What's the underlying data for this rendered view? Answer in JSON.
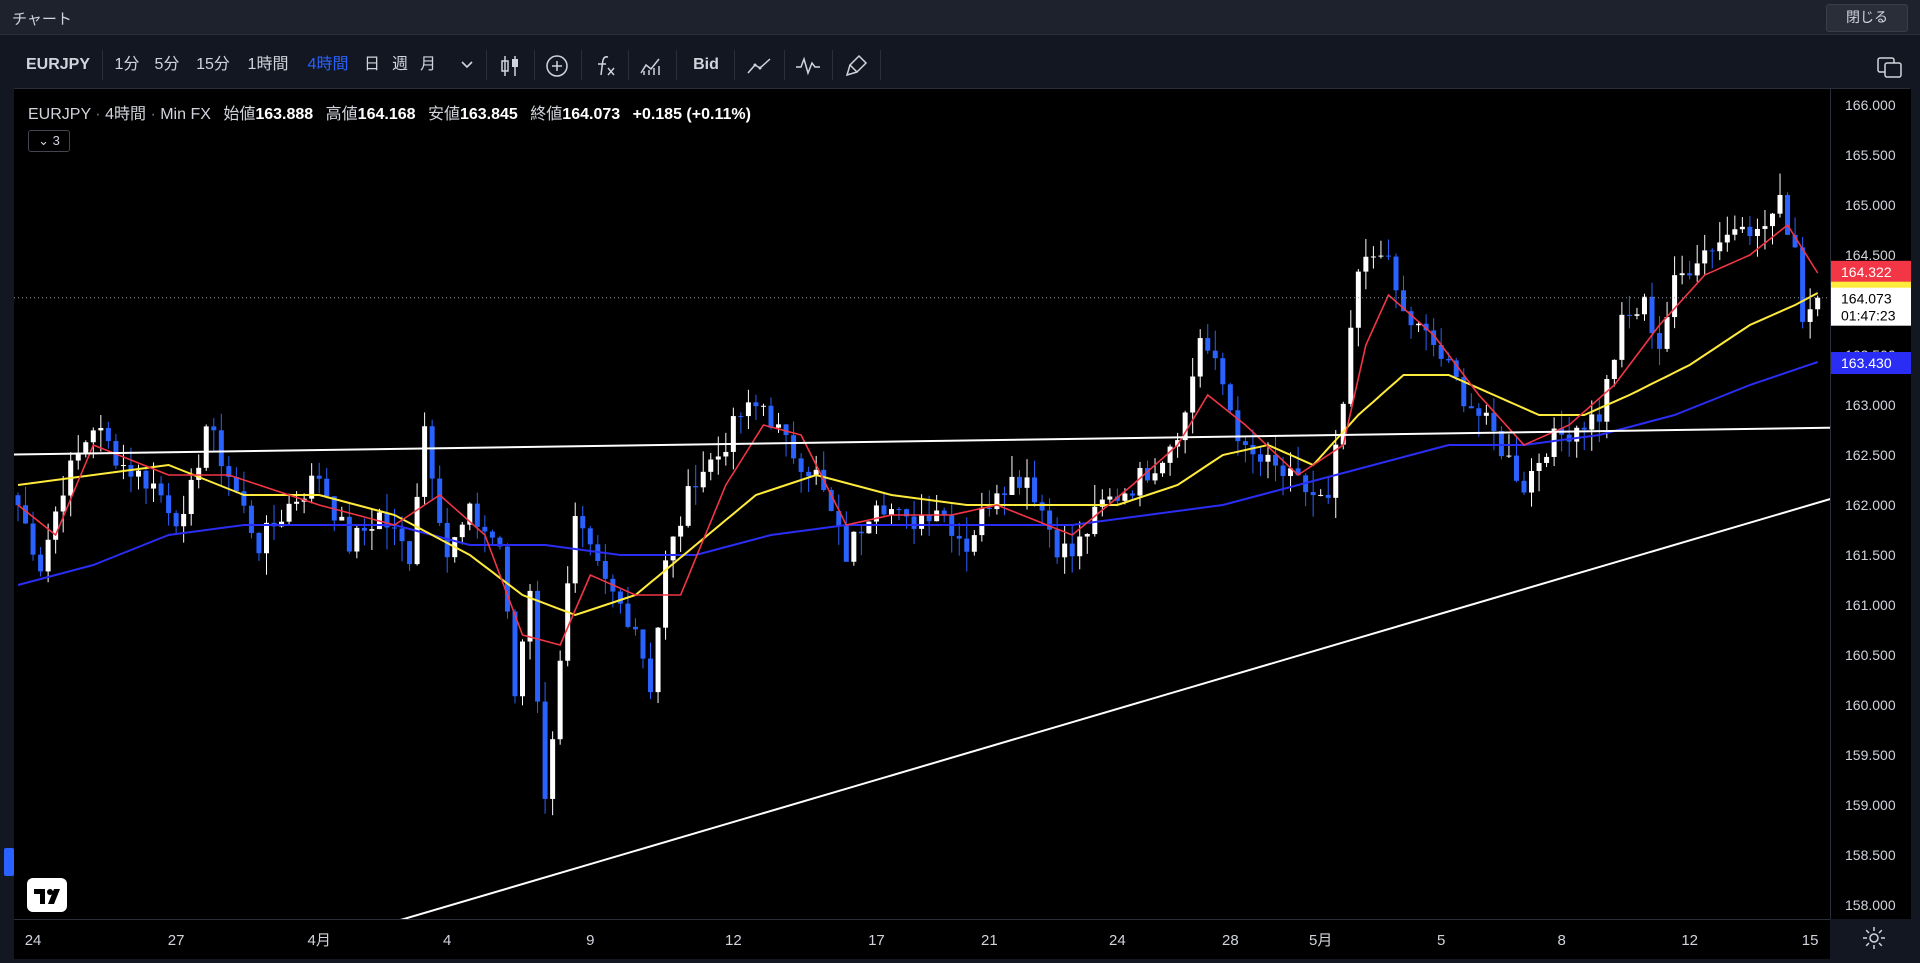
{
  "window": {
    "title": "チャート",
    "close_label": "閉じる"
  },
  "toolbar": {
    "symbol": "EURJPY",
    "intervals": [
      "1分",
      "5分",
      "15分",
      "1時間",
      "4時間",
      "日",
      "週",
      "月"
    ],
    "active_interval": "4時間",
    "bid_label": "Bid"
  },
  "legend": {
    "symbol": "EURJPY",
    "interval": "4時間",
    "source": "Min FX",
    "open_label": "始値",
    "open": "163.888",
    "high_label": "高値",
    "high": "164.168",
    "low_label": "安値",
    "low": "163.845",
    "close_label": "終値",
    "close": "164.073",
    "change": "+0.185 (+0.11%)",
    "indicator_count": "3"
  },
  "price_badges": [
    {
      "value": "164.322",
      "color": "#f23645"
    },
    {
      "value": "164.123",
      "color": "#ffeb3b"
    },
    {
      "value": "164.073",
      "countdown": "01:47:23",
      "color": "#ffffff"
    },
    {
      "value": "163.430",
      "color": "#2a2ef5"
    }
  ],
  "colors": {
    "bull": "#ffffff",
    "bear": "#2962ff",
    "ma_fast": "#f23645",
    "ma_mid": "#ffeb3b",
    "ma_slow": "#2a2ef5",
    "trendline": "#ffffff"
  },
  "chart_data": {
    "type": "candlestick",
    "y_ticks": [
      "166.000",
      "165.500",
      "165.000",
      "164.500",
      "164.000",
      "163.500",
      "163.000",
      "162.500",
      "162.000",
      "161.500",
      "161.000",
      "160.500",
      "160.000",
      "159.500",
      "159.000",
      "158.500",
      "158.000"
    ],
    "ylim": [
      157.8,
      166.1
    ],
    "x_ticks": [
      "24",
      "27",
      "4月",
      "4",
      "9",
      "12",
      "17",
      "21",
      "24",
      "28",
      "5月",
      "5",
      "8",
      "12",
      "15"
    ],
    "x_tick_idx": [
      2,
      21,
      40,
      57,
      76,
      95,
      114,
      129,
      146,
      161,
      173,
      189,
      205,
      222,
      238
    ],
    "n_candles": 240,
    "anchors": [
      [
        0,
        162.0
      ],
      [
        3,
        161.4
      ],
      [
        6,
        162.2
      ],
      [
        10,
        162.8
      ],
      [
        14,
        162.4
      ],
      [
        18,
        162.2
      ],
      [
        22,
        161.8
      ],
      [
        25,
        162.8
      ],
      [
        28,
        162.3
      ],
      [
        32,
        161.6
      ],
      [
        36,
        162.0
      ],
      [
        40,
        162.3
      ],
      [
        44,
        161.6
      ],
      [
        48,
        161.9
      ],
      [
        52,
        161.5
      ],
      [
        54,
        162.8
      ],
      [
        57,
        161.5
      ],
      [
        60,
        161.9
      ],
      [
        64,
        161.6
      ],
      [
        66,
        160.1
      ],
      [
        68,
        161.2
      ],
      [
        70,
        159.0
      ],
      [
        72,
        160.5
      ],
      [
        74,
        161.8
      ],
      [
        78,
        161.2
      ],
      [
        82,
        160.8
      ],
      [
        84,
        160.2
      ],
      [
        86,
        161.4
      ],
      [
        90,
        162.3
      ],
      [
        93,
        162.5
      ],
      [
        96,
        162.9
      ],
      [
        99,
        163.0
      ],
      [
        102,
        162.6
      ],
      [
        106,
        162.3
      ],
      [
        110,
        161.5
      ],
      [
        114,
        162.1
      ],
      [
        118,
        161.8
      ],
      [
        122,
        162.0
      ],
      [
        126,
        161.6
      ],
      [
        130,
        162.2
      ],
      [
        134,
        162.3
      ],
      [
        138,
        161.6
      ],
      [
        140,
        161.5
      ],
      [
        144,
        162.0
      ],
      [
        148,
        162.2
      ],
      [
        152,
        162.5
      ],
      [
        155,
        162.9
      ],
      [
        157,
        163.7
      ],
      [
        160,
        163.2
      ],
      [
        163,
        162.5
      ],
      [
        166,
        162.4
      ],
      [
        170,
        162.2
      ],
      [
        174,
        162.0
      ],
      [
        176,
        163.0
      ],
      [
        178,
        164.3
      ],
      [
        181,
        164.6
      ],
      [
        184,
        163.9
      ],
      [
        188,
        163.6
      ],
      [
        192,
        163.1
      ],
      [
        196,
        162.7
      ],
      [
        200,
        162.2
      ],
      [
        203,
        162.6
      ],
      [
        207,
        162.8
      ],
      [
        210,
        162.9
      ],
      [
        213,
        163.8
      ],
      [
        216,
        164.0
      ],
      [
        218,
        163.6
      ],
      [
        220,
        164.2
      ],
      [
        223,
        164.5
      ],
      [
        227,
        164.7
      ],
      [
        229,
        164.9
      ],
      [
        231,
        164.7
      ],
      [
        234,
        165.0
      ],
      [
        236,
        164.6
      ],
      [
        237,
        163.9
      ],
      [
        239,
        164.07
      ]
    ],
    "ma_fast": [
      [
        0,
        162.0
      ],
      [
        5,
        161.7
      ],
      [
        10,
        162.6
      ],
      [
        20,
        162.3
      ],
      [
        28,
        162.3
      ],
      [
        40,
        162.0
      ],
      [
        50,
        161.8
      ],
      [
        56,
        162.1
      ],
      [
        62,
        161.7
      ],
      [
        67,
        160.7
      ],
      [
        72,
        160.6
      ],
      [
        76,
        161.3
      ],
      [
        82,
        161.1
      ],
      [
        88,
        161.1
      ],
      [
        94,
        162.2
      ],
      [
        99,
        162.8
      ],
      [
        104,
        162.7
      ],
      [
        110,
        161.8
      ],
      [
        116,
        161.9
      ],
      [
        124,
        161.9
      ],
      [
        130,
        162.0
      ],
      [
        140,
        161.7
      ],
      [
        148,
        162.2
      ],
      [
        154,
        162.6
      ],
      [
        158,
        163.1
      ],
      [
        163,
        162.8
      ],
      [
        170,
        162.3
      ],
      [
        176,
        162.6
      ],
      [
        179,
        163.6
      ],
      [
        182,
        164.1
      ],
      [
        188,
        163.7
      ],
      [
        194,
        163.1
      ],
      [
        200,
        162.6
      ],
      [
        206,
        162.8
      ],
      [
        212,
        163.2
      ],
      [
        218,
        163.8
      ],
      [
        224,
        164.3
      ],
      [
        230,
        164.5
      ],
      [
        235,
        164.8
      ],
      [
        239,
        164.32
      ]
    ],
    "ma_mid": [
      [
        0,
        162.2
      ],
      [
        10,
        162.3
      ],
      [
        20,
        162.4
      ],
      [
        30,
        162.1
      ],
      [
        40,
        162.1
      ],
      [
        50,
        161.9
      ],
      [
        60,
        161.5
      ],
      [
        67,
        161.1
      ],
      [
        74,
        160.9
      ],
      [
        82,
        161.1
      ],
      [
        90,
        161.6
      ],
      [
        98,
        162.1
      ],
      [
        106,
        162.3
      ],
      [
        116,
        162.1
      ],
      [
        126,
        162.0
      ],
      [
        136,
        162.0
      ],
      [
        146,
        162.0
      ],
      [
        154,
        162.2
      ],
      [
        160,
        162.5
      ],
      [
        166,
        162.6
      ],
      [
        172,
        162.4
      ],
      [
        178,
        162.9
      ],
      [
        184,
        163.3
      ],
      [
        190,
        163.3
      ],
      [
        196,
        163.1
      ],
      [
        202,
        162.9
      ],
      [
        208,
        162.9
      ],
      [
        214,
        163.1
      ],
      [
        222,
        163.4
      ],
      [
        230,
        163.8
      ],
      [
        236,
        164.0
      ],
      [
        239,
        164.12
      ]
    ],
    "ma_slow": [
      [
        0,
        161.2
      ],
      [
        10,
        161.4
      ],
      [
        20,
        161.7
      ],
      [
        30,
        161.8
      ],
      [
        40,
        161.8
      ],
      [
        50,
        161.8
      ],
      [
        60,
        161.6
      ],
      [
        70,
        161.6
      ],
      [
        80,
        161.5
      ],
      [
        90,
        161.5
      ],
      [
        100,
        161.7
      ],
      [
        110,
        161.8
      ],
      [
        120,
        161.8
      ],
      [
        130,
        161.8
      ],
      [
        140,
        161.8
      ],
      [
        150,
        161.9
      ],
      [
        160,
        162.0
      ],
      [
        170,
        162.2
      ],
      [
        180,
        162.4
      ],
      [
        190,
        162.6
      ],
      [
        200,
        162.6
      ],
      [
        210,
        162.7
      ],
      [
        220,
        162.9
      ],
      [
        230,
        163.2
      ],
      [
        239,
        163.43
      ]
    ],
    "trendlines": [
      {
        "x1": -5,
        "y1": 162.5,
        "x2": 247,
        "y2": 162.78
      },
      {
        "x1": 35,
        "y1": 157.5,
        "x2": 247,
        "y2": 162.2
      }
    ]
  }
}
